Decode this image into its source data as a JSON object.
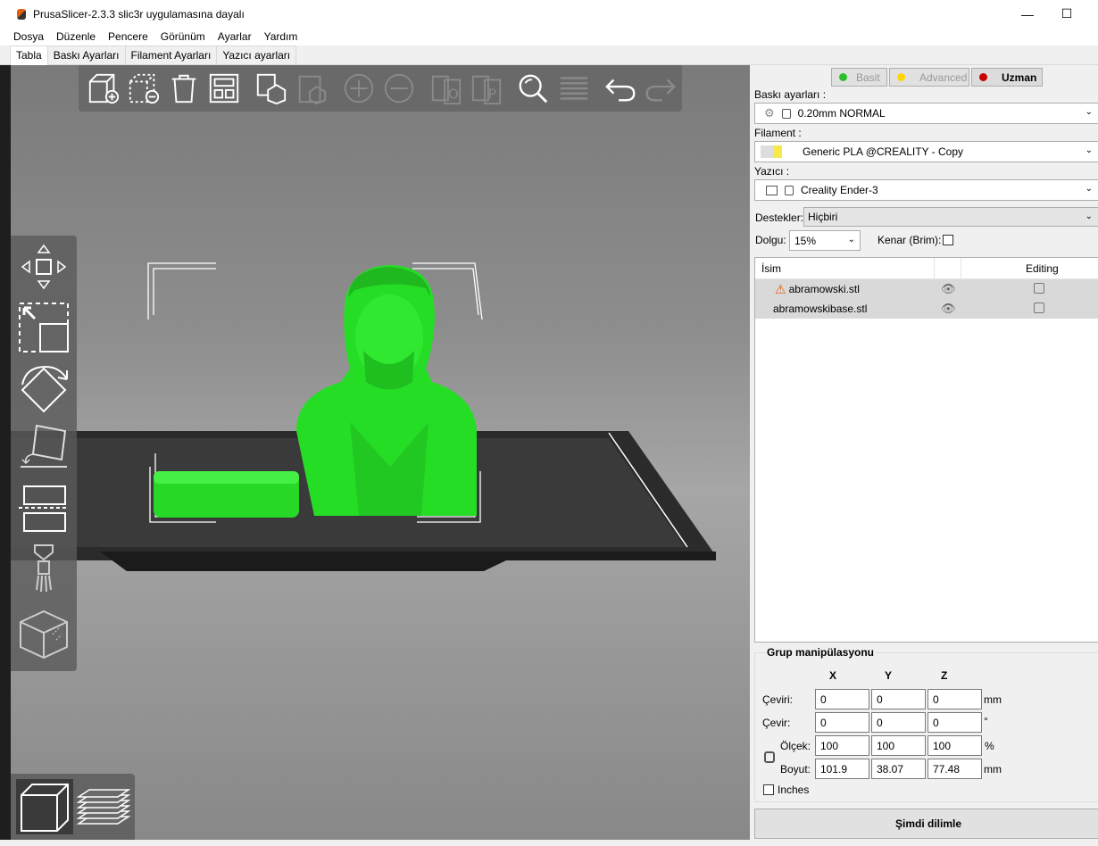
{
  "window": {
    "title": "PrusaSlicer-2.3.3 slic3r uygulamasına dayalı",
    "minimize": "—",
    "maximize": "☐"
  },
  "menu": [
    "Dosya",
    "Düzenle",
    "Pencere",
    "Görünüm",
    "Ayarlar",
    "Yardım"
  ],
  "tabs": [
    "Tabla",
    "Baskı Ayarları",
    "Filament Ayarları",
    "Yazıcı ayarları"
  ],
  "modes": {
    "basic": "Basit",
    "advanced": "Advanced",
    "expert": "Uzman"
  },
  "colors": {
    "basic": "#28c228",
    "advanced": "#ffd700",
    "expert": "#c80000",
    "model": "#2ee82e",
    "filament_swatch": "#f5e94b"
  },
  "print_settings": {
    "label": "Baskı ayarları :",
    "value": "0.20mm NORMAL"
  },
  "filament": {
    "label": "Filament :",
    "value": "Generic PLA @CREALITY - Copy"
  },
  "printer": {
    "label": "Yazıcı :",
    "value": "Creality Ender-3"
  },
  "supports": {
    "label": "Destekler:",
    "value": "Hiçbiri"
  },
  "infill": {
    "label": "Dolgu:",
    "value": "15%"
  },
  "brim": {
    "label": "Kenar (Brim):"
  },
  "object_list": {
    "col_name": "İsim",
    "col_editing": "Editing",
    "rows": [
      {
        "name": "abramowski.stl",
        "warning": true
      },
      {
        "name": "abramowskibase.stl",
        "warning": false
      }
    ]
  },
  "manipulation": {
    "title": "Grup manipülasyonu",
    "x": "X",
    "y": "Y",
    "z": "Z",
    "position": {
      "label": "Çeviri:",
      "x": "0",
      "y": "0",
      "z": "0",
      "unit": "mm"
    },
    "rotation": {
      "label": "Çevir:",
      "x": "0",
      "y": "0",
      "z": "0",
      "unit": "°"
    },
    "scale": {
      "label": "Ölçek:",
      "x": "100",
      "y": "100",
      "z": "100",
      "unit": "%"
    },
    "size": {
      "label": "Boyut:",
      "x": "101.9",
      "y": "38.07",
      "z": "77.48",
      "unit": "mm"
    },
    "inches": "Inches"
  },
  "slice_button": "Şimdi dilimle"
}
